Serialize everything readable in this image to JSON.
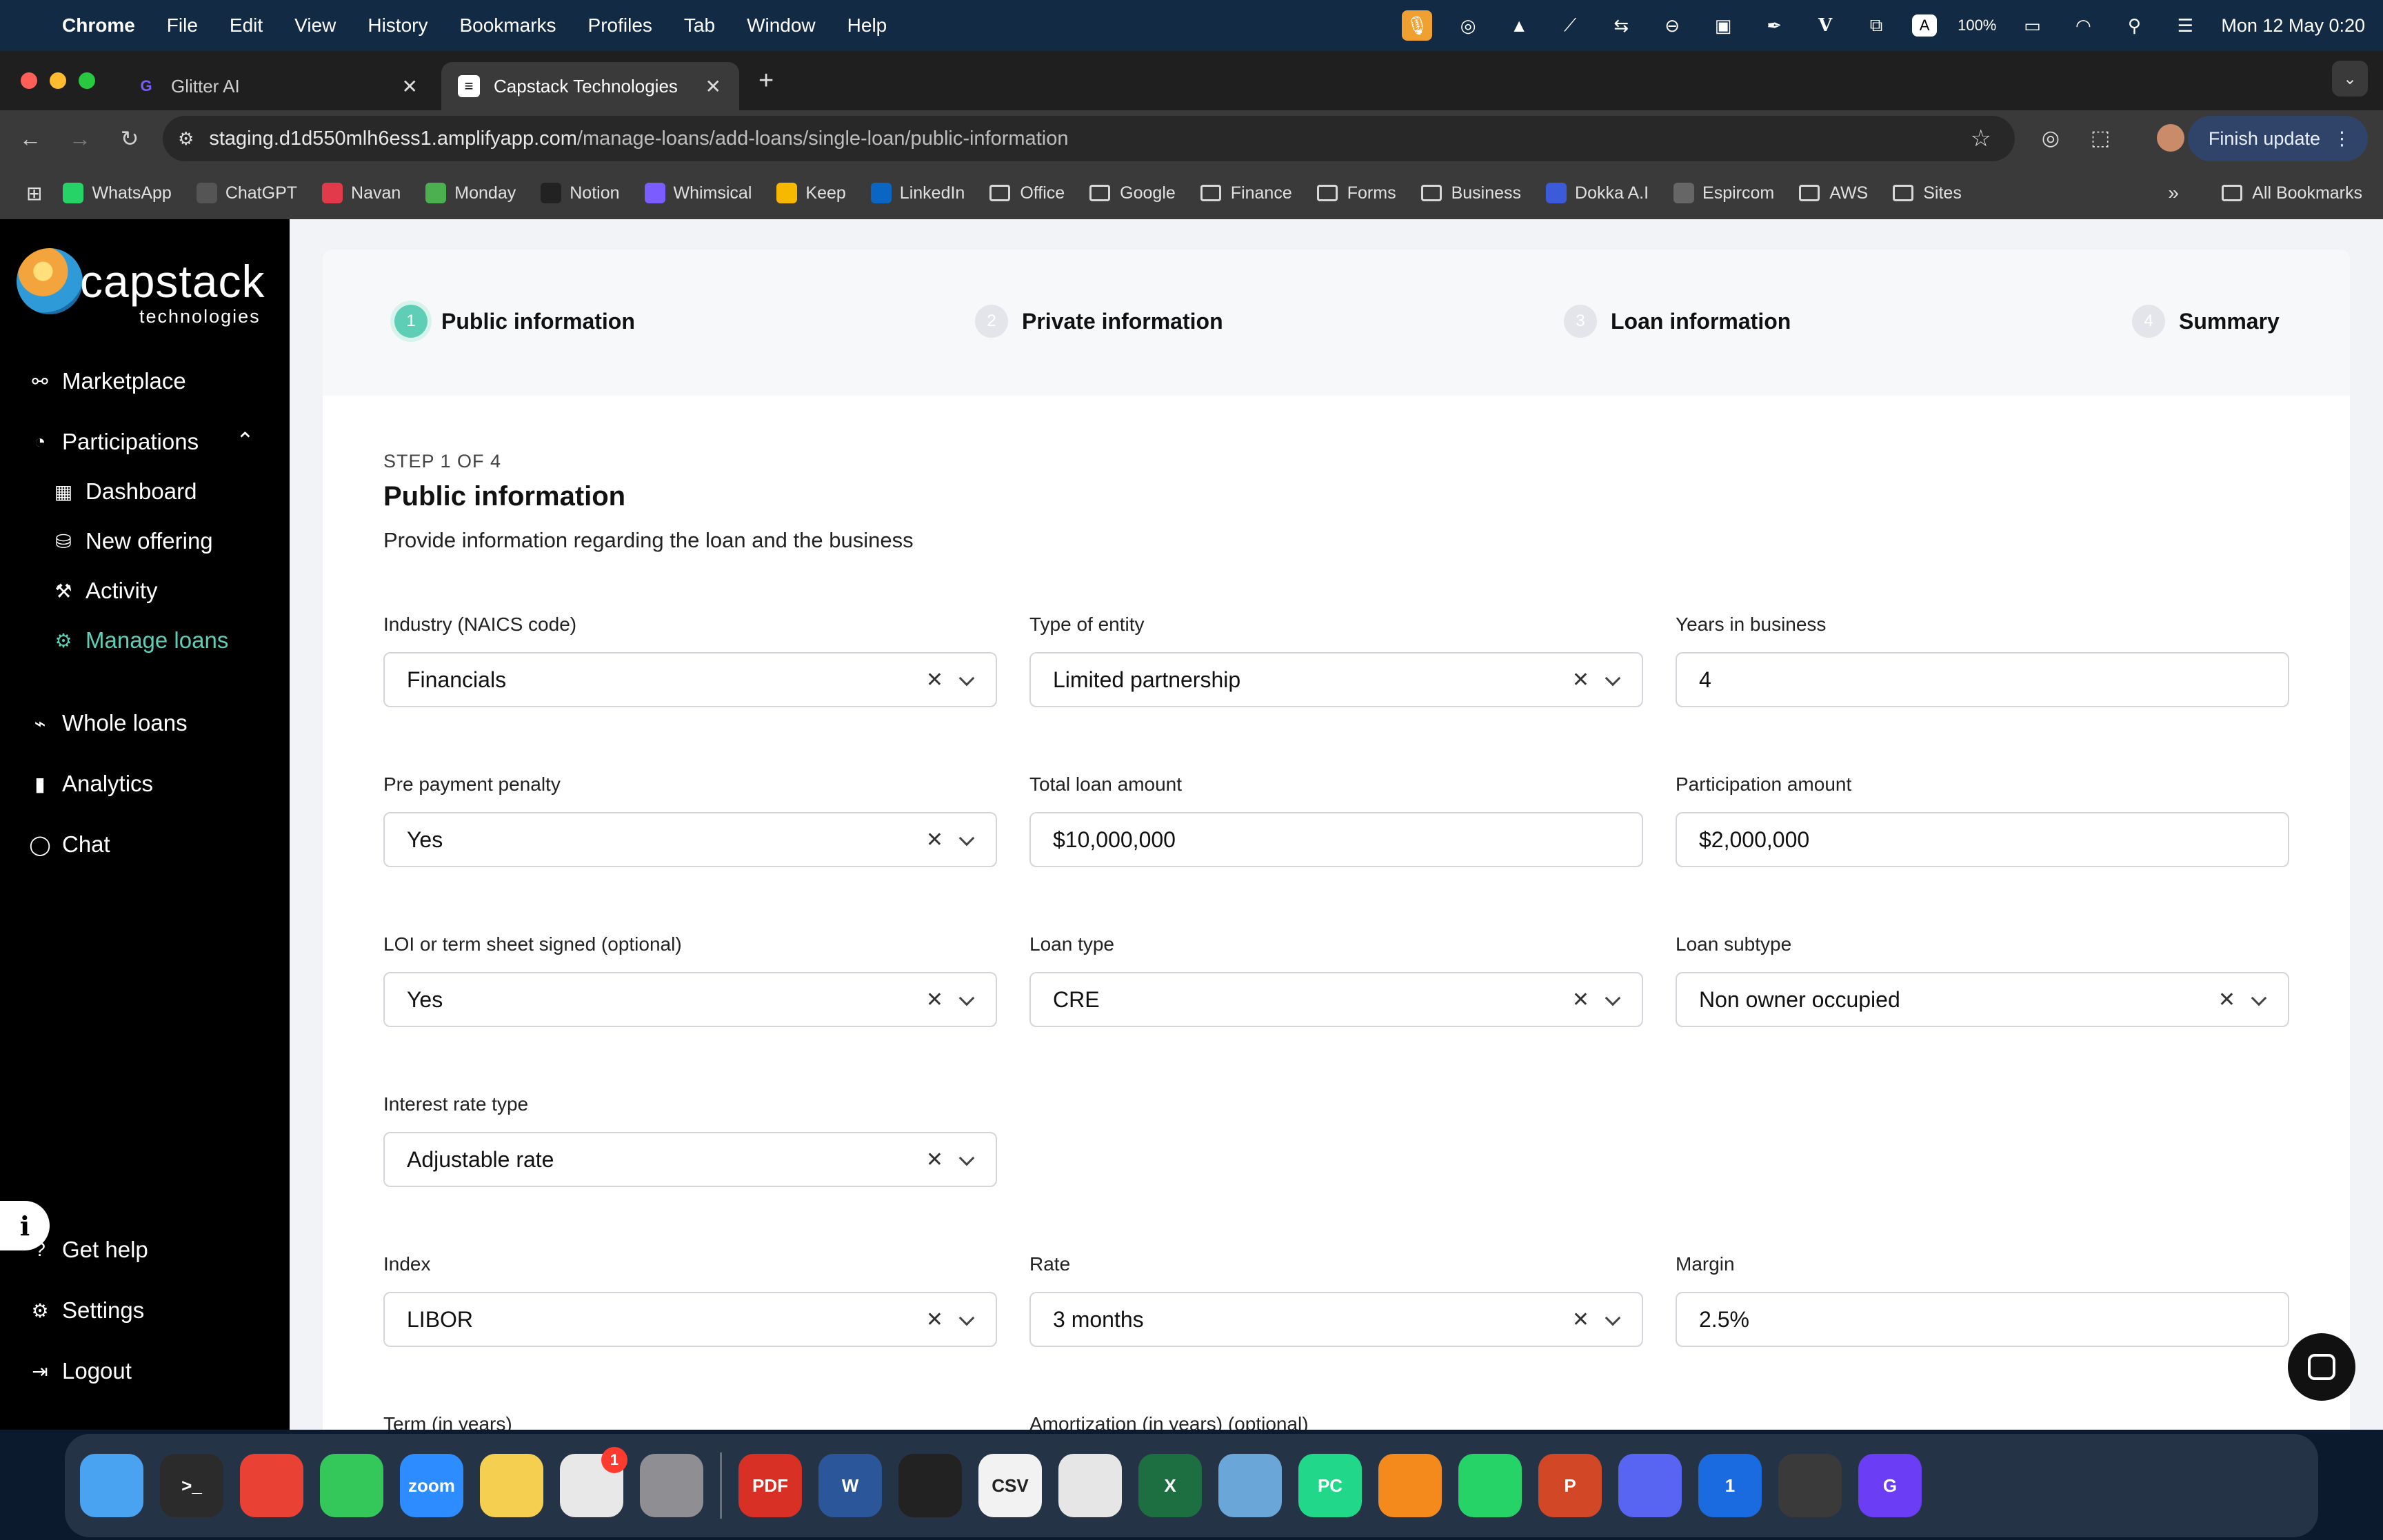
{
  "menubar": {
    "app_name": "Chrome",
    "menus": [
      "File",
      "Edit",
      "View",
      "History",
      "Bookmarks",
      "Profiles",
      "Tab",
      "Window",
      "Help"
    ],
    "battery": "100%",
    "datetime": "Mon 12 May  0:20"
  },
  "tabs": [
    {
      "title": "Glitter AI",
      "active": false
    },
    {
      "title": "Capstack Technologies",
      "active": true
    }
  ],
  "address": {
    "host": "staging.d1d550mlh6ess1.amplifyapp.com",
    "path": "/manage-loans/add-loans/single-loan/public-information"
  },
  "toolbar": {
    "finish_update": "Finish update"
  },
  "bookmarks": [
    {
      "label": "WhatsApp",
      "icon": "whatsapp-icon",
      "color": "#25d366"
    },
    {
      "label": "ChatGPT",
      "icon": "chatgpt-icon",
      "color": "#555555"
    },
    {
      "label": "Navan",
      "icon": "navan-icon",
      "color": "#e23a4a"
    },
    {
      "label": "Monday",
      "icon": "monday-icon",
      "color": "#4caf50"
    },
    {
      "label": "Notion",
      "icon": "notion-icon",
      "color": "#222222"
    },
    {
      "label": "Whimsical",
      "icon": "whimsical-icon",
      "color": "#7b5cff"
    },
    {
      "label": "Keep",
      "icon": "keep-icon",
      "color": "#f7b900"
    },
    {
      "label": "LinkedIn",
      "icon": "linkedin-icon",
      "color": "#0a66c2"
    },
    {
      "label": "Office",
      "icon": "folder-icon",
      "color": ""
    },
    {
      "label": "Google",
      "icon": "folder-icon",
      "color": ""
    },
    {
      "label": "Finance",
      "icon": "folder-icon",
      "color": ""
    },
    {
      "label": "Forms",
      "icon": "folder-icon",
      "color": ""
    },
    {
      "label": "Business",
      "icon": "folder-icon",
      "color": ""
    },
    {
      "label": "Dokka A.I",
      "icon": "dokka-icon",
      "color": "#3b5bdb"
    },
    {
      "label": "Espircom",
      "icon": "espircom-icon",
      "color": "#666666"
    },
    {
      "label": "AWS",
      "icon": "folder-icon",
      "color": ""
    },
    {
      "label": "Sites",
      "icon": "folder-icon",
      "color": ""
    }
  ],
  "all_bookmarks": "All Bookmarks",
  "sidebar": {
    "logo_text": "capstack",
    "logo_sub": "technologies",
    "items": [
      {
        "label": "Marketplace",
        "icon": "marketplace-icon"
      },
      {
        "label": "Participations",
        "icon": "pie-chart-icon"
      },
      {
        "label": "Dashboard",
        "icon": "dashboard-grid-icon"
      },
      {
        "label": "New offering",
        "icon": "new-offering-icon"
      },
      {
        "label": "Activity",
        "icon": "gavel-icon"
      },
      {
        "label": "Manage loans",
        "icon": "manage-loans-icon"
      },
      {
        "label": "Whole loans",
        "icon": "pulse-icon"
      },
      {
        "label": "Analytics",
        "icon": "bar-chart-icon"
      },
      {
        "label": "Chat",
        "icon": "chat-bubble-icon"
      },
      {
        "label": "Get help",
        "icon": "help-icon"
      },
      {
        "label": "Settings",
        "icon": "gear-icon"
      },
      {
        "label": "Logout",
        "icon": "logout-icon"
      }
    ],
    "accent": "#5ecfb6"
  },
  "stepper": [
    {
      "num": "1",
      "label": "Public information"
    },
    {
      "num": "2",
      "label": "Private information"
    },
    {
      "num": "3",
      "label": "Loan information"
    },
    {
      "num": "4",
      "label": "Summary"
    }
  ],
  "form": {
    "step_count": "STEP 1 OF 4",
    "title": "Public information",
    "subtitle": "Provide information regarding the loan and the business",
    "fields": [
      {
        "label": "Industry (NAICS code)",
        "value": "Financials",
        "kind": "select"
      },
      {
        "label": "Type of entity",
        "value": "Limited partnership",
        "kind": "select"
      },
      {
        "label": "Years in business",
        "value": "4",
        "kind": "input"
      },
      {
        "label": "Pre payment penalty",
        "value": "Yes",
        "kind": "select"
      },
      {
        "label": "Total loan amount",
        "value": "$10,000,000",
        "kind": "input"
      },
      {
        "label": "Participation amount",
        "value": "$2,000,000",
        "kind": "input"
      },
      {
        "label": "LOI or term sheet signed (optional)",
        "value": "Yes",
        "kind": "select"
      },
      {
        "label": "Loan type",
        "value": "CRE",
        "kind": "select"
      },
      {
        "label": "Loan subtype",
        "value": "Non owner occupied",
        "kind": "select"
      },
      {
        "label": "Interest rate type",
        "value": "Adjustable rate",
        "kind": "select"
      },
      {
        "label": "Index",
        "value": "LIBOR",
        "kind": "select"
      },
      {
        "label": "Rate",
        "value": "3 months",
        "kind": "select"
      },
      {
        "label": "Margin",
        "value": "2.5%",
        "kind": "input"
      },
      {
        "label": "Term (in years)",
        "value": "",
        "kind": "input"
      },
      {
        "label": "Amortization (in years) (optional)",
        "value": "",
        "kind": "input"
      }
    ]
  },
  "dock": [
    {
      "label": "",
      "icon": "finder-icon",
      "color": "#4aa3f0"
    },
    {
      "label": ">_",
      "icon": "terminal-icon",
      "color": "#2b2b2b"
    },
    {
      "label": "",
      "icon": "chrome-icon",
      "color": "#e94235"
    },
    {
      "label": "",
      "icon": "messages-icon",
      "color": "#34c759"
    },
    {
      "label": "zoom",
      "icon": "zoom-icon",
      "color": "#2d8cff"
    },
    {
      "label": "",
      "icon": "notes-icon",
      "color": "#f5d050"
    },
    {
      "label": "",
      "icon": "slack-icon",
      "color": "#e8e8e8",
      "badge": "1"
    },
    {
      "label": "",
      "icon": "system-settings-icon",
      "color": "#8e8e93"
    },
    {
      "label": "PDF",
      "icon": "pdf-icon",
      "color": "#d93025"
    },
    {
      "label": "W",
      "icon": "word-icon",
      "color": "#2b579a"
    },
    {
      "label": "",
      "icon": "activity-monitor-icon",
      "color": "#222222"
    },
    {
      "label": "CSV",
      "icon": "csv-editor-icon",
      "color": "#f2f2f2"
    },
    {
      "label": "",
      "icon": "textedit-icon",
      "color": "#e6e6e6"
    },
    {
      "label": "X",
      "icon": "excel-icon",
      "color": "#1d6f42"
    },
    {
      "label": "",
      "icon": "preview-icon",
      "color": "#6aa7d8"
    },
    {
      "label": "PC",
      "icon": "pycharm-icon",
      "color": "#21d789"
    },
    {
      "label": "",
      "icon": "vlc-icon",
      "color": "#f48a1b"
    },
    {
      "label": "",
      "icon": "whatsapp-icon",
      "color": "#25d366"
    },
    {
      "label": "P",
      "icon": "powerpoint-icon",
      "color": "#d24726"
    },
    {
      "label": "",
      "icon": "discord-icon",
      "color": "#5865f2"
    },
    {
      "label": "1",
      "icon": "1password-icon",
      "color": "#1a6be0"
    },
    {
      "label": "",
      "icon": "quicktime-icon",
      "color": "#3a3a3a"
    },
    {
      "label": "G",
      "icon": "glitter-icon",
      "color": "#6b3df5"
    }
  ]
}
